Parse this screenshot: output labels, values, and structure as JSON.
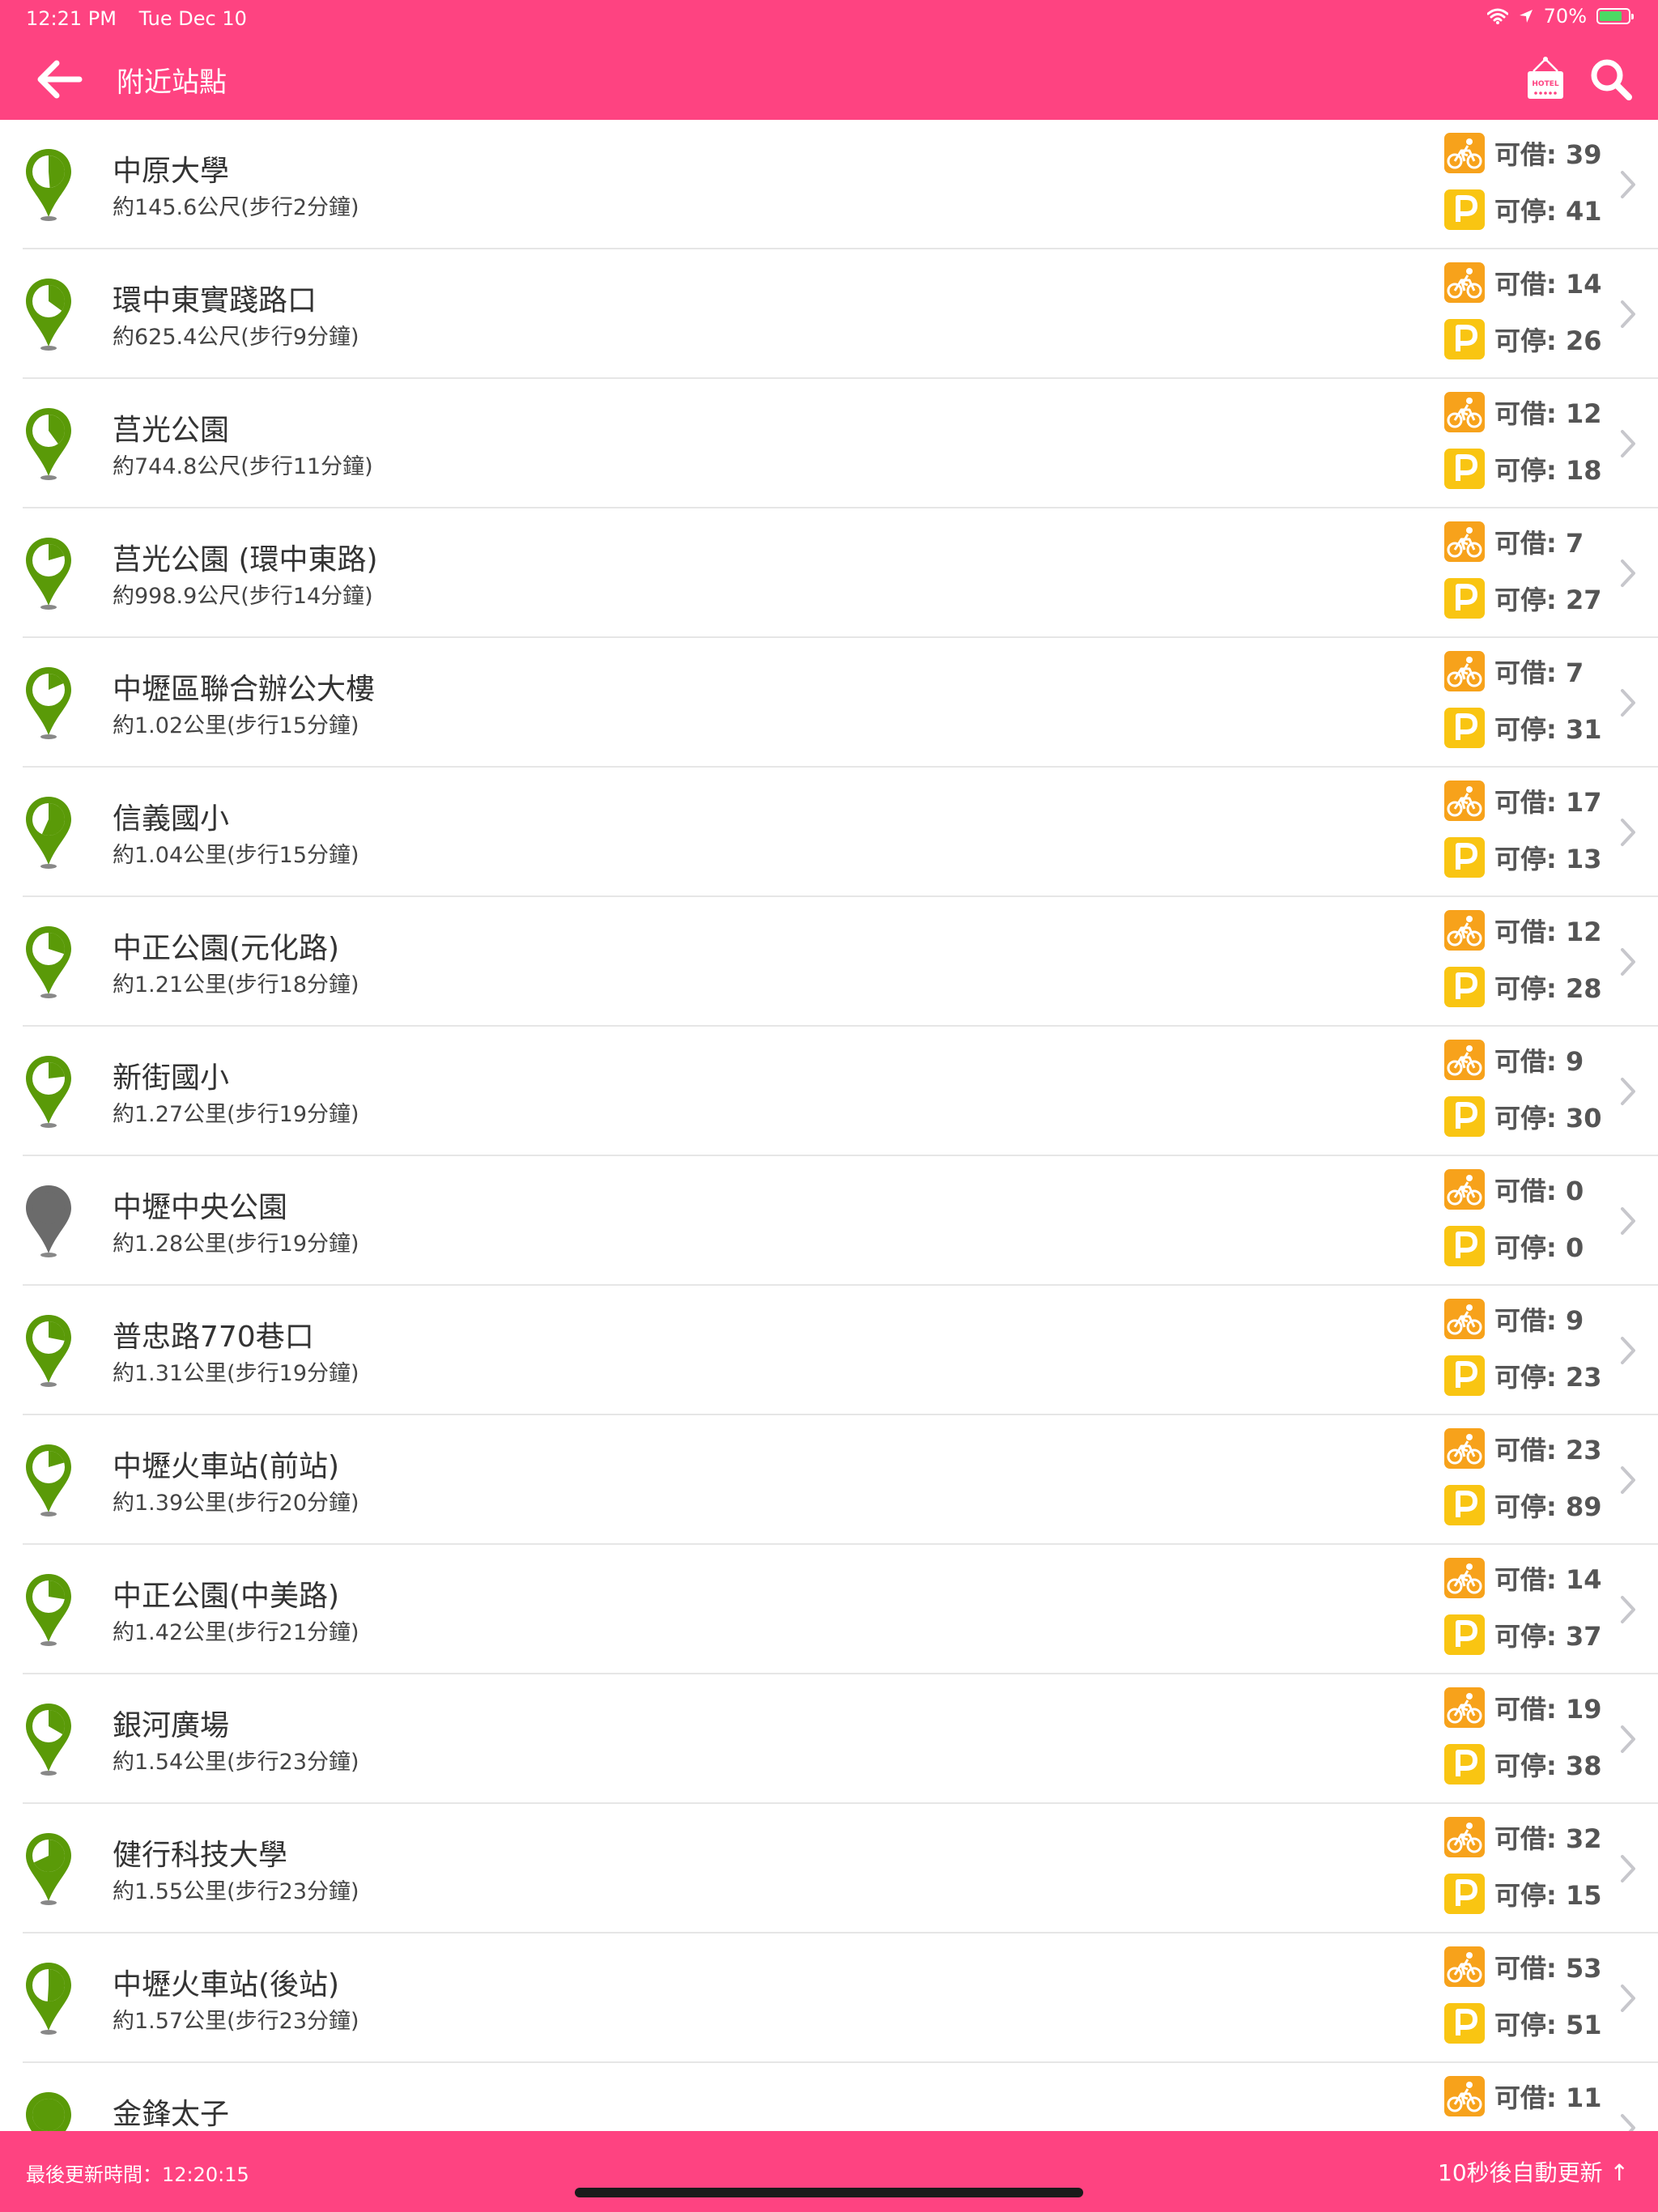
{
  "status_bar": {
    "time": "12:21 PM",
    "date": "Tue Dec 10",
    "battery": "70%"
  },
  "header": {
    "title": "附近站點",
    "hotel_icon_text": "HOTEL"
  },
  "labels": {
    "borrow": "可借:",
    "park": "可停:"
  },
  "colors": {
    "accent": "#fe4381",
    "pin_active": "#5a9a08",
    "pin_inactive": "#6b6b6b",
    "bike_badge": "#f7a21b",
    "parking_badge": "#f9c512"
  },
  "stations": [
    {
      "name": "中原大學",
      "distance": "約145.6公尺(步行2分鐘)",
      "borrow": 39,
      "park": 41,
      "active": true
    },
    {
      "name": "環中東實踐路口",
      "distance": "約625.4公尺(步行9分鐘)",
      "borrow": 14,
      "park": 26,
      "active": true
    },
    {
      "name": "莒光公園",
      "distance": "約744.8公尺(步行11分鐘)",
      "borrow": 12,
      "park": 18,
      "active": true
    },
    {
      "name": "莒光公園 (環中東路)",
      "distance": "約998.9公尺(步行14分鐘)",
      "borrow": 7,
      "park": 27,
      "active": true
    },
    {
      "name": "中壢區聯合辦公大樓",
      "distance": "約1.02公里(步行15分鐘)",
      "borrow": 7,
      "park": 31,
      "active": true
    },
    {
      "name": "信義國小",
      "distance": "約1.04公里(步行15分鐘)",
      "borrow": 17,
      "park": 13,
      "active": true
    },
    {
      "name": "中正公園(元化路)",
      "distance": "約1.21公里(步行18分鐘)",
      "borrow": 12,
      "park": 28,
      "active": true
    },
    {
      "name": "新街國小",
      "distance": "約1.27公里(步行19分鐘)",
      "borrow": 9,
      "park": 30,
      "active": true
    },
    {
      "name": "中壢中央公園",
      "distance": "約1.28公里(步行19分鐘)",
      "borrow": 0,
      "park": 0,
      "active": false
    },
    {
      "name": "普忠路770巷口",
      "distance": "約1.31公里(步行19分鐘)",
      "borrow": 9,
      "park": 23,
      "active": true
    },
    {
      "name": "中壢火車站(前站)",
      "distance": "約1.39公里(步行20分鐘)",
      "borrow": 23,
      "park": 89,
      "active": true
    },
    {
      "name": "中正公園(中美路)",
      "distance": "約1.42公里(步行21分鐘)",
      "borrow": 14,
      "park": 37,
      "active": true
    },
    {
      "name": "銀河廣場",
      "distance": "約1.54公里(步行23分鐘)",
      "borrow": 19,
      "park": 38,
      "active": true
    },
    {
      "name": "健行科技大學",
      "distance": "約1.55公里(步行23分鐘)",
      "borrow": 32,
      "park": 15,
      "active": true
    },
    {
      "name": "中壢火車站(後站)",
      "distance": "約1.57公里(步行23分鐘)",
      "borrow": 53,
      "park": 51,
      "active": true
    },
    {
      "name": "金鋒太子",
      "distance": "",
      "borrow": 11,
      "park": null,
      "active": true
    }
  ],
  "footer": {
    "last_update": "最後更新時間：12:20:15",
    "auto_update": "10秒後自動更新 ↑"
  }
}
